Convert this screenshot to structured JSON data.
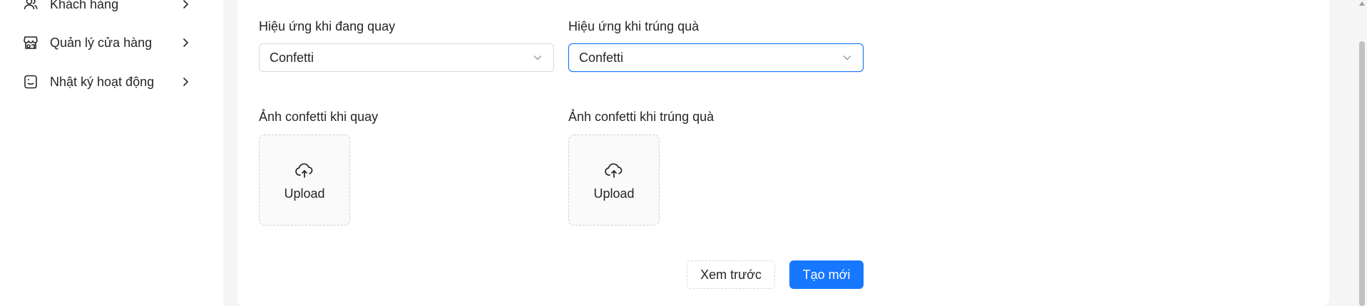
{
  "sidebar": {
    "items": [
      {
        "label": "Khách hàng",
        "icon": "users-icon"
      },
      {
        "label": "Quản lý cửa hàng",
        "icon": "store-icon"
      },
      {
        "label": "Nhật ký hoạt động",
        "icon": "activity-log-icon"
      }
    ]
  },
  "form": {
    "spin_effect": {
      "label": "Hiệu ứng khi đang quay",
      "value": "Confetti"
    },
    "win_effect": {
      "label": "Hiệu ứng khi trúng quà",
      "value": "Confetti"
    },
    "spin_confetti_image": {
      "label": "Ảnh confetti khi quay",
      "upload_label": "Upload"
    },
    "win_confetti_image": {
      "label": "Ảnh confetti khi trúng quà",
      "upload_label": "Upload"
    }
  },
  "actions": {
    "preview_label": "Xem trước",
    "create_label": "Tạo mới"
  },
  "colors": {
    "primary": "#1677ff",
    "border": "#d9d9d9",
    "background": "#f5f5f5"
  }
}
